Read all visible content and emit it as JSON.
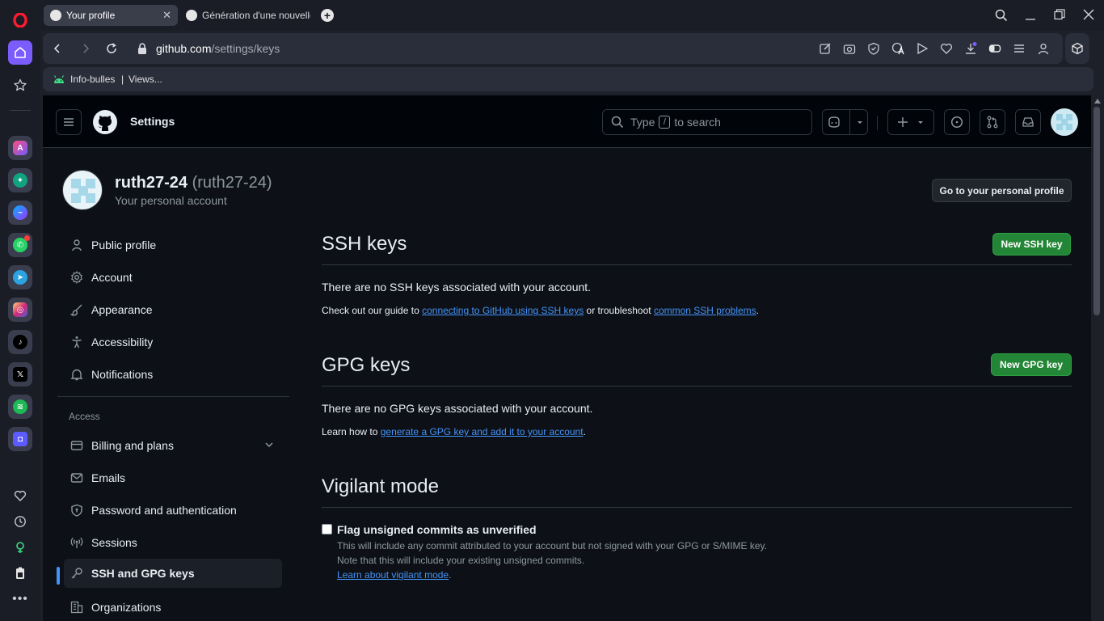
{
  "browser": {
    "tabs": [
      {
        "title": "Your profile",
        "active": true
      },
      {
        "title": "Génération d'une nouvelle",
        "active": false
      }
    ],
    "url_host": "github.com",
    "url_path": "/settings/keys",
    "bookmarks": [
      "Info-bulles",
      "|",
      "Views..."
    ]
  },
  "github": {
    "header_title": "Settings",
    "search_prefix": "Type",
    "search_key": "/",
    "search_suffix": "to search"
  },
  "profile": {
    "username": "ruth27-24",
    "handle": "(ruth27-24)",
    "subtitle": "Your personal account",
    "go_profile_button": "Go to your personal profile"
  },
  "sidebar_nav": {
    "items": [
      {
        "label": "Public profile",
        "icon": "person-icon"
      },
      {
        "label": "Account",
        "icon": "gear-icon"
      },
      {
        "label": "Appearance",
        "icon": "paintbrush-icon"
      },
      {
        "label": "Accessibility",
        "icon": "accessibility-icon"
      },
      {
        "label": "Notifications",
        "icon": "bell-icon"
      }
    ],
    "access_heading": "Access",
    "access_items": [
      {
        "label": "Billing and plans",
        "icon": "credit-card-icon"
      },
      {
        "label": "Emails",
        "icon": "mail-icon"
      },
      {
        "label": "Password and authentication",
        "icon": "shield-lock-icon"
      },
      {
        "label": "Sessions",
        "icon": "broadcast-icon"
      },
      {
        "label": "SSH and GPG keys",
        "icon": "key-icon",
        "active": true
      },
      {
        "label": "Organizations",
        "icon": "organization-icon"
      }
    ]
  },
  "ssh": {
    "title": "SSH keys",
    "new_button": "New SSH key",
    "empty": "There are no SSH keys associated with your account.",
    "help_prefix": "Check out our guide to",
    "help_link1": "connecting to GitHub using SSH keys",
    "help_middle": "or troubleshoot",
    "help_link2": "common SSH problems",
    "help_end": "."
  },
  "gpg": {
    "title": "GPG keys",
    "new_button": "New GPG key",
    "empty": "There are no GPG keys associated with your account.",
    "help_prefix": "Learn how to",
    "help_link": "generate a GPG key and add it to your account",
    "help_end": "."
  },
  "vigilant": {
    "title": "Vigilant mode",
    "checkbox_label": "Flag unsigned commits as unverified",
    "checked": false,
    "desc1": "This will include any commit attributed to your account but not signed with your GPG or S/MIME key.",
    "desc2": "Note that this will include your existing unsigned commits.",
    "learn_link": "Learn about vigilant mode",
    "learn_end": "."
  },
  "colors": {
    "accent_link": "#4493f8",
    "primary_button": "#238636",
    "opera_red": "#ff1b2d",
    "opera_home": "#7b5cff"
  }
}
